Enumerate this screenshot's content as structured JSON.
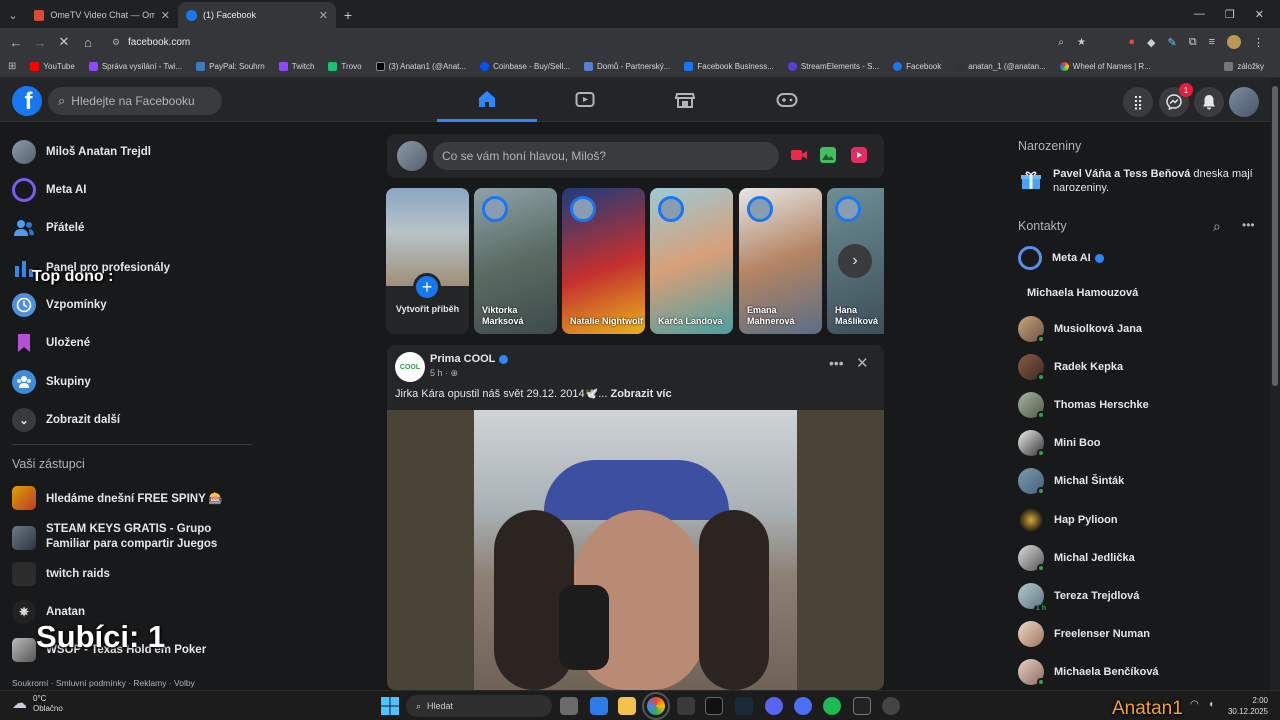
{
  "browser": {
    "tabs": [
      {
        "label": "OmeTV Video Chat — Ome",
        "active": false
      },
      {
        "label": "(1) Facebook",
        "active": true
      }
    ],
    "url": "facebook.com",
    "bookmarks": [
      "YouTube",
      "Správa vysílání - Twi...",
      "PayPal: Souhrn",
      "Twitch",
      "Trovo",
      "(3) Anatan1 (@Anat...",
      "Coinbase - Buy/Sell...",
      "Domů - Partnerský...",
      "Facebook Business...",
      "StreamElements - S...",
      "Facebook",
      "anatan_1 (@anatan...",
      "Wheel of Names | R..."
    ],
    "bookmarks_overflow": "záložky"
  },
  "fb": {
    "search_placeholder": "Hledejte na Facebooku",
    "messenger_badge": "1"
  },
  "left_nav": {
    "items": [
      {
        "label": "Miloš Anatan Trejdl",
        "icon": "avatar"
      },
      {
        "label": "Meta AI",
        "icon": "meta-ai-icon"
      },
      {
        "label": "Přátelé",
        "icon": "friends-icon"
      },
      {
        "label": "Panel pro profesionály",
        "icon": "chart-icon"
      },
      {
        "label": "Vzpomínky",
        "icon": "clock-icon"
      },
      {
        "label": "Uložené",
        "icon": "bookmark-icon"
      },
      {
        "label": "Skupiny",
        "icon": "groups-icon"
      },
      {
        "label": "Zobrazit další",
        "icon": "chevron-down-icon"
      }
    ],
    "shortcuts_title": "Vaši zástupci",
    "shortcuts": [
      {
        "label": "Hledáme dnešní FREE SPINY 🎰"
      },
      {
        "label": "STEAM KEYS GRATIS - Grupo Familiar para compartir Juegos"
      },
      {
        "label": "twitch raids"
      },
      {
        "label": "Anatan"
      },
      {
        "label": "WSOP - Texas Hold'em Poker"
      }
    ],
    "footer": "Soukromí · Smluvní podmínky · Reklamy · Volby"
  },
  "overlays": {
    "top_dono": "Top dono :",
    "subs": "Subíci: 1",
    "watermark": "Anatan1"
  },
  "composer": {
    "placeholder": "Co se vám honí hlavou, Miloš?"
  },
  "stories": [
    {
      "name": "Vytvořit příběh",
      "create": true
    },
    {
      "name": "Viktorka Marksová"
    },
    {
      "name": "Natalie Nightwolf"
    },
    {
      "name": "Karča Landova"
    },
    {
      "name": "Emana Mahnerová"
    },
    {
      "name": "Hana Mašlíková"
    }
  ],
  "post": {
    "author": "Prima COOL",
    "time": "5 h · ",
    "text": "Jirka Kára opustil náš svět 29.12. 2014🕊️... ",
    "more": "Zobrazit víc",
    "avatar_text": "COOL"
  },
  "right": {
    "birthdays_title": "Narozeniny",
    "birthday_names": "Pavel Váňa a Tess Beňová",
    "birthday_rest": " dneska mají narozeniny.",
    "contacts_title": "Kontakty",
    "contacts": [
      {
        "name": "Meta AI",
        "verified": true,
        "online": false
      },
      {
        "name": "Michaela Hamouzová",
        "online": false
      },
      {
        "name": "Musiolková Jana",
        "online": true
      },
      {
        "name": "Radek Kepka",
        "online": true
      },
      {
        "name": "Thomas Herschke",
        "online": true
      },
      {
        "name": "Mini Boo",
        "online": true
      },
      {
        "name": "Michal Šinták",
        "online": true
      },
      {
        "name": "Hap Pylioon",
        "online": false
      },
      {
        "name": "Michal Jedlička",
        "online": true
      },
      {
        "name": "Tereza Trejdlová",
        "online": false,
        "status": "1 h"
      },
      {
        "name": "Freelenser Numan",
        "online": false
      },
      {
        "name": "Michaela Benčíková",
        "online": true
      }
    ]
  },
  "taskbar": {
    "temp": "0°C",
    "weather": "Oblačno",
    "search": "Hledat",
    "time": "2:00",
    "date": "30.12.2025"
  }
}
